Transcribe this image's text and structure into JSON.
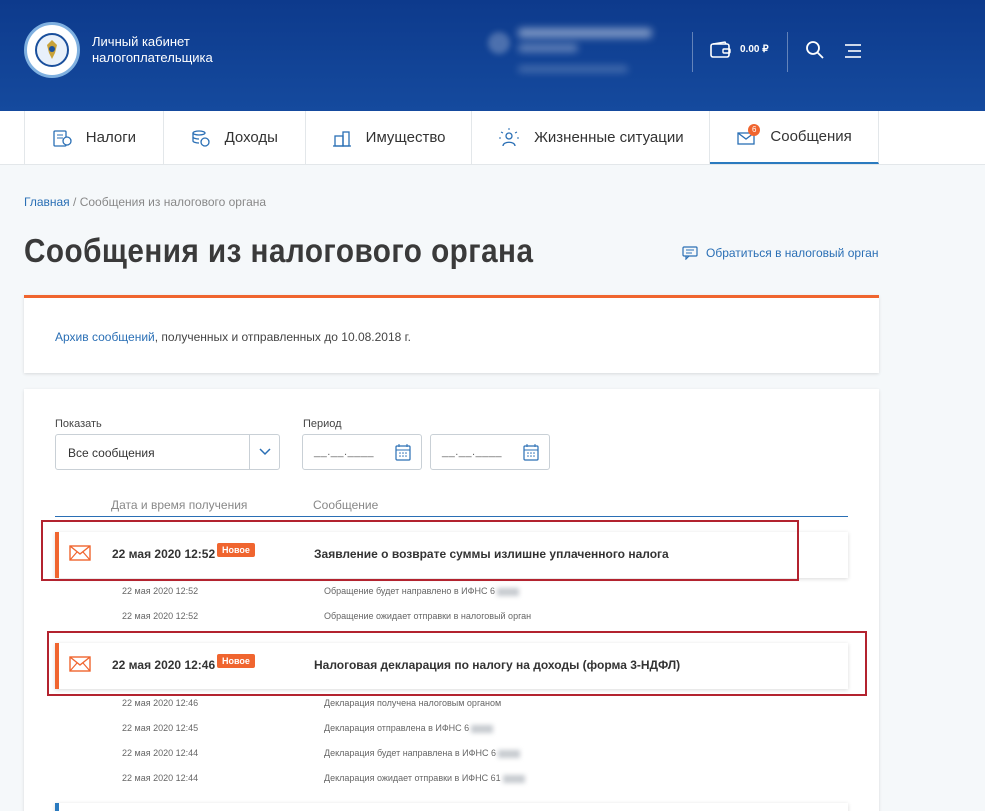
{
  "header": {
    "brand_line1": "Личный кабинет",
    "brand_line2": "налогоплательщика",
    "balance": "0.00 ₽"
  },
  "nav": {
    "items": [
      {
        "label": "Налоги",
        "icon": "taxes-icon"
      },
      {
        "label": "Доходы",
        "icon": "income-icon"
      },
      {
        "label": "Имущество",
        "icon": "property-icon"
      },
      {
        "label": "Жизненные ситуации",
        "icon": "life-situations-icon"
      },
      {
        "label": "Сообщения",
        "icon": "messages-icon",
        "badge": "6",
        "active": true
      }
    ]
  },
  "breadcrumb": {
    "home": "Главная",
    "separator": " / ",
    "current": "Сообщения из налогового органа"
  },
  "page": {
    "title": "Сообщения из налогового органа",
    "contact_link": "Обратиться в налоговый орган"
  },
  "archive": {
    "link": "Архив сообщений",
    "text": ", полученных и отправленных до 10.08.2018 г."
  },
  "filters": {
    "show_label": "Показать",
    "show_value": "Все сообщения",
    "period_label": "Период",
    "date_placeholder": "__.__.____"
  },
  "table": {
    "col_date": "Дата и время получения",
    "col_message": "Сообщение"
  },
  "messages": [
    {
      "datetime": "22 мая 2020 12:52",
      "badge": "Новое",
      "subject": "Заявление о возврате суммы излишне уплаченного налога",
      "history": [
        {
          "datetime": "22 мая 2020 12:52",
          "text": "Обращение будет направлено в ИФНС 6"
        },
        {
          "datetime": "22 мая 2020 12:52",
          "text": "Обращение ожидает отправки в налоговый орган"
        }
      ]
    },
    {
      "datetime": "22 мая 2020 12:46",
      "badge": "Новое",
      "subject": "Налоговая декларация по налогу на доходы (форма 3-НДФЛ)",
      "history": [
        {
          "datetime": "22 мая 2020 12:46",
          "text": "Декларация получена налоговым органом"
        },
        {
          "datetime": "22 мая 2020 12:45",
          "text": "Декларация отправлена в ИФНС 6"
        },
        {
          "datetime": "22 мая 2020 12:44",
          "text": "Декларация будет направлена в ИФНС 6"
        },
        {
          "datetime": "22 мая 2020 12:44",
          "text": "Декларация ожидает отправки в ИФНС 61"
        }
      ]
    }
  ],
  "colors": {
    "header_blue": "#0d3a8c",
    "accent_orange": "#f0652f",
    "link_blue": "#2a6fb5",
    "highlight_red": "#b3232f"
  }
}
